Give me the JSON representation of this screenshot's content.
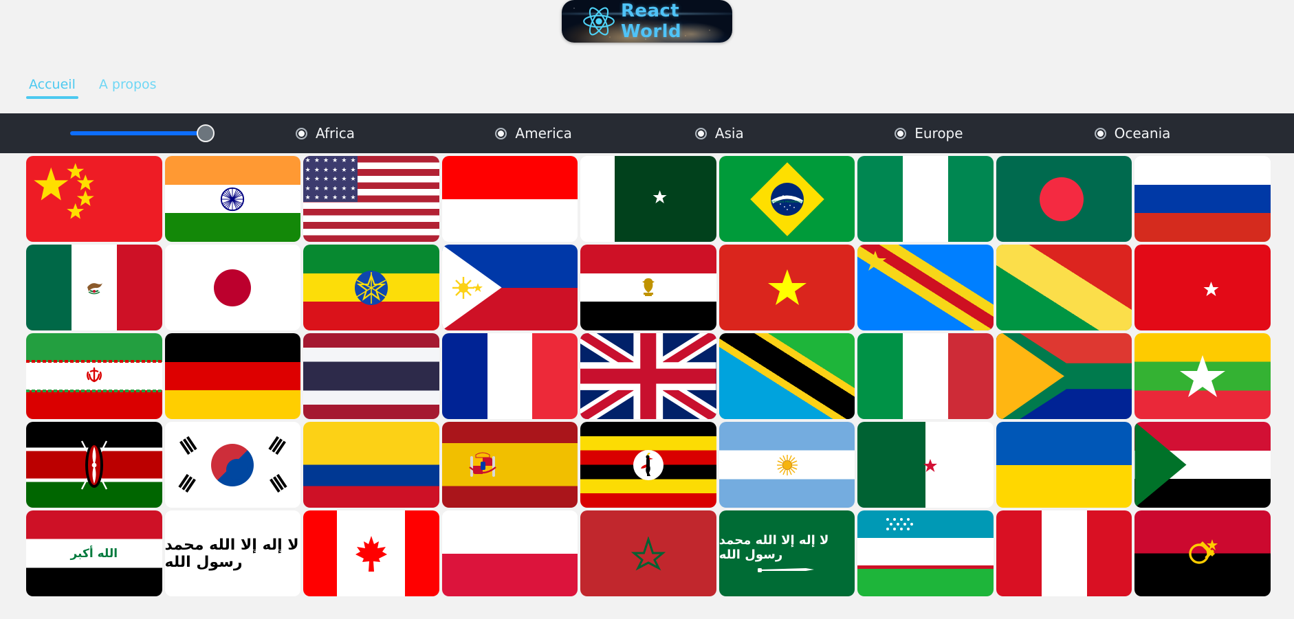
{
  "app": {
    "logo_title": "React World",
    "logo_icon": "react-atom-icon",
    "banner_image": "earth-from-space-night"
  },
  "nav": {
    "tabs": [
      {
        "label": "Accueil",
        "active": true
      },
      {
        "label": "A propos",
        "active": false
      }
    ]
  },
  "toolbar": {
    "slider": {
      "name": "count-slider",
      "value": 100,
      "min": 0,
      "max": 100,
      "fill_color": "#0d6efd",
      "thumb_color": "#6c757d"
    },
    "background_color": "#272b33",
    "radios": [
      {
        "label": "Africa",
        "selected": false
      },
      {
        "label": "America",
        "selected": false
      },
      {
        "label": "Asia",
        "selected": false
      },
      {
        "label": "Europe",
        "selected": false
      },
      {
        "label": "Oceania",
        "selected": false
      }
    ]
  },
  "grid": {
    "columns": 9,
    "flags": [
      {
        "name": "China",
        "code": "cn"
      },
      {
        "name": "India",
        "code": "in"
      },
      {
        "name": "United States",
        "code": "us"
      },
      {
        "name": "Indonesia",
        "code": "id"
      },
      {
        "name": "Pakistan",
        "code": "pk"
      },
      {
        "name": "Brazil",
        "code": "br"
      },
      {
        "name": "Nigeria",
        "code": "ng"
      },
      {
        "name": "Bangladesh",
        "code": "bd"
      },
      {
        "name": "Russia",
        "code": "ru"
      },
      {
        "name": "Mexico",
        "code": "mx"
      },
      {
        "name": "Japan",
        "code": "jp"
      },
      {
        "name": "Ethiopia",
        "code": "et"
      },
      {
        "name": "Philippines",
        "code": "ph"
      },
      {
        "name": "Egypt",
        "code": "eg"
      },
      {
        "name": "Vietnam",
        "code": "vn"
      },
      {
        "name": "DR Congo",
        "code": "cd"
      },
      {
        "name": "Congo",
        "code": "cg"
      },
      {
        "name": "Turkey",
        "code": "tr"
      },
      {
        "name": "Iran",
        "code": "ir"
      },
      {
        "name": "Germany",
        "code": "de"
      },
      {
        "name": "Thailand",
        "code": "th"
      },
      {
        "name": "France",
        "code": "fr"
      },
      {
        "name": "United Kingdom",
        "code": "gb"
      },
      {
        "name": "Tanzania",
        "code": "tz"
      },
      {
        "name": "Italy",
        "code": "it"
      },
      {
        "name": "South Africa",
        "code": "za"
      },
      {
        "name": "Myanmar",
        "code": "mm"
      },
      {
        "name": "Kenya",
        "code": "ke"
      },
      {
        "name": "South Korea",
        "code": "kr"
      },
      {
        "name": "Colombia",
        "code": "co"
      },
      {
        "name": "Spain",
        "code": "es"
      },
      {
        "name": "Uganda",
        "code": "ug"
      },
      {
        "name": "Argentina",
        "code": "ar"
      },
      {
        "name": "Algeria",
        "code": "dz"
      },
      {
        "name": "Ukraine",
        "code": "ua"
      },
      {
        "name": "Sudan",
        "code": "sd"
      },
      {
        "name": "Iraq",
        "code": "iq"
      },
      {
        "name": "Afghanistan",
        "code": "af"
      },
      {
        "name": "Canada",
        "code": "ca"
      },
      {
        "name": "Poland",
        "code": "pl"
      },
      {
        "name": "Morocco",
        "code": "ma"
      },
      {
        "name": "Saudi Arabia",
        "code": "sa"
      },
      {
        "name": "Uzbekistan",
        "code": "uz"
      },
      {
        "name": "Peru",
        "code": "pe"
      },
      {
        "name": "Angola",
        "code": "ao"
      }
    ]
  }
}
